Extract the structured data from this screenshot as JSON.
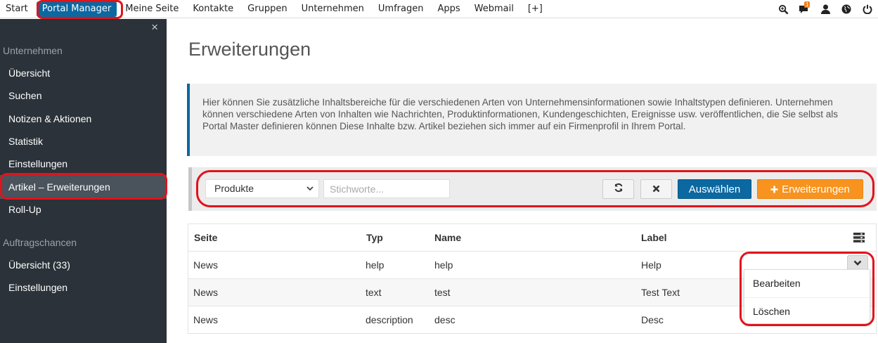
{
  "topnav": {
    "items": [
      {
        "label": "Start"
      },
      {
        "label": "Portal Manager",
        "active": true
      },
      {
        "label": "Meine Seite"
      },
      {
        "label": "Kontakte"
      },
      {
        "label": "Gruppen"
      },
      {
        "label": "Unternehmen"
      },
      {
        "label": "Umfragen"
      },
      {
        "label": "Apps"
      },
      {
        "label": "Webmail"
      },
      {
        "label": "[+]"
      }
    ],
    "icons": [
      "search-icon",
      "chat-icon",
      "user-icon",
      "globe-icon",
      "power-icon"
    ],
    "chat_badge": "1"
  },
  "sidebar": {
    "close_symbol": "×",
    "section1": "Unternehmen",
    "items1": [
      {
        "label": "Übersicht"
      },
      {
        "label": "Suchen"
      },
      {
        "label": "Notizen & Aktionen"
      },
      {
        "label": "Statistik"
      },
      {
        "label": "Einstellungen"
      },
      {
        "label": "Artikel – Erweiterungen",
        "active": true
      },
      {
        "label": "Roll-Up"
      }
    ],
    "section2": "Auftragschancen",
    "items2": [
      {
        "label": "Übersicht (33)"
      },
      {
        "label": "Einstellungen"
      }
    ]
  },
  "main": {
    "title": "Erweiterungen",
    "info": "Hier können Sie zusätzliche Inhaltsbereiche für die verschiedenen Arten von Unternehmensinformationen sowie Inhaltstypen definieren. Unternehmen können verschiedene Arten von Inhalten wie Nachrichten, Produktinformationen, Kundengeschichten, Ereignisse usw. veröffentlichen, die Sie selbst als Portal Master definieren können Diese Inhalte bzw. Artikel beziehen sich immer auf ein Firmenprofil in Ihrem Portal."
  },
  "filter": {
    "select_value": "Produkte",
    "search_placeholder": "Stichworte...",
    "select_button": "Auswählen",
    "add_button": "Erweiterungen"
  },
  "table": {
    "columns": [
      "Seite",
      "Typ",
      "Name",
      "Label"
    ],
    "rows": [
      {
        "seite": "News",
        "typ": "help",
        "name": "help",
        "label": "Help"
      },
      {
        "seite": "News",
        "typ": "text",
        "name": "test",
        "label": "Test Text"
      },
      {
        "seite": "News",
        "typ": "description",
        "name": "desc",
        "label": "Desc"
      }
    ]
  },
  "dropdown": {
    "items": [
      "Bearbeiten",
      "Löschen"
    ]
  },
  "colors": {
    "primary": "#0b68a1",
    "accent": "#f7931e",
    "sidebar_bg": "#2b3239",
    "highlight": "#e1131b"
  }
}
